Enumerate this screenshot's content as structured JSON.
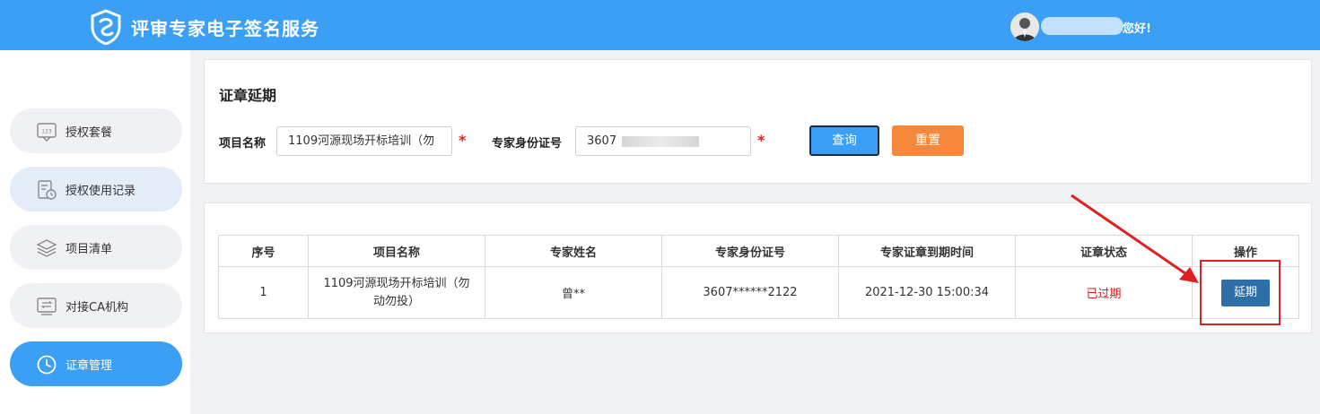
{
  "header": {
    "app_title": "评审专家电子签名服务",
    "greeting": "您好!",
    "logo_icon": "shield-logo-icon",
    "avatar_icon": "user-avatar-icon"
  },
  "sidebar": {
    "items": [
      {
        "label": "授权套餐",
        "icon": "package-123-icon"
      },
      {
        "label": "授权使用记录",
        "icon": "record-clock-icon"
      },
      {
        "label": "项目清单",
        "icon": "layers-icon"
      },
      {
        "label": "对接CA机构",
        "icon": "transfer-icon"
      },
      {
        "label": "证章管理",
        "icon": "clock-icon",
        "active": true
      }
    ]
  },
  "search": {
    "title": "证章延期",
    "project_label": "项目名称",
    "project_value": "1109河源现场开标培训（勿",
    "id_label": "专家身份证号",
    "id_value": "3607",
    "required_mark": "*",
    "query_label": "查询",
    "reset_label": "重置"
  },
  "table": {
    "headers": [
      "序号",
      "项目名称",
      "专家姓名",
      "专家身份证号",
      "专家证章到期时间",
      "证章状态",
      "操作"
    ],
    "rows": [
      {
        "index": "1",
        "project": "1109河源现场开标培训（勿动勿投）",
        "name": "曾**",
        "id": "3607******2122",
        "expire": "2021-12-30 15:00:34",
        "status": "已过期",
        "action": "延期"
      }
    ]
  },
  "colors": {
    "brand": "#3a9ff5",
    "reset": "#f5883a",
    "action": "#2f6fa9",
    "expired": "#d01c1c",
    "annotation": "#e02020"
  }
}
